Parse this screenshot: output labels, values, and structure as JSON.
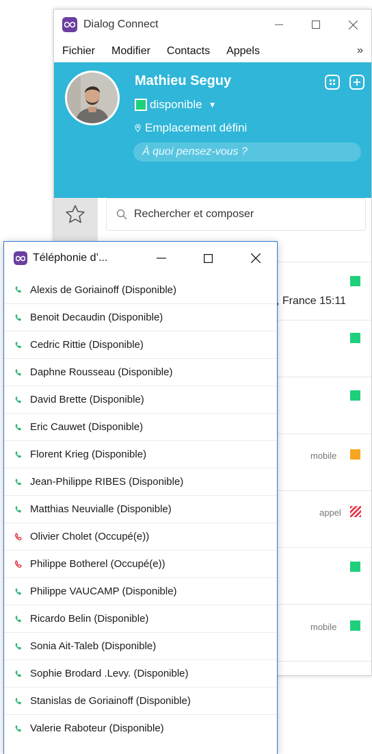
{
  "main_window": {
    "title": "Dialog Connect",
    "menu": [
      "Fichier",
      "Modifier",
      "Contacts",
      "Appels"
    ],
    "menu_more": "»",
    "profile": {
      "name": "Mathieu Seguy",
      "status": "disponible",
      "location": "Emplacement défini",
      "mood_placeholder": "À quoi pensez-vous ?"
    },
    "search_placeholder": "Rechercher et composer",
    "partial_texts": {
      "row1": ", France 15:11",
      "mobile": "mobile",
      "appel": "appel"
    },
    "colors": {
      "header": "#2fb6d8",
      "available": "#1fd07a",
      "mobile": "#f6a623",
      "busy": "#e83a4c",
      "logo": "#6b3fa0"
    }
  },
  "telephony_window": {
    "title": "Téléphonie d’...",
    "contacts": [
      {
        "name": "Alexis de Goriainoff (Disponible)",
        "status": "available"
      },
      {
        "name": "Benoit Decaudin (Disponible)",
        "status": "available"
      },
      {
        "name": "Cedric Rittie (Disponible)",
        "status": "available"
      },
      {
        "name": "Daphne Rousseau (Disponible)",
        "status": "available"
      },
      {
        "name": "David Brette (Disponible)",
        "status": "available"
      },
      {
        "name": "Eric Cauwet (Disponible)",
        "status": "available"
      },
      {
        "name": "Florent Krieg (Disponible)",
        "status": "available"
      },
      {
        "name": "Jean-Philippe RIBES (Disponible)",
        "status": "available"
      },
      {
        "name": "Matthias Neuvialle (Disponible)",
        "status": "available"
      },
      {
        "name": "Olivier Cholet (Occupé(e))",
        "status": "busy"
      },
      {
        "name": "Philippe Botherel (Occupé(e))",
        "status": "busy"
      },
      {
        "name": "Philippe VAUCAMP (Disponible)",
        "status": "available"
      },
      {
        "name": "Ricardo Belin (Disponible)",
        "status": "available"
      },
      {
        "name": "Sonia Ait-Taleb (Disponible)",
        "status": "available"
      },
      {
        "name": "Sophie Brodard .Levy. (Disponible)",
        "status": "available"
      },
      {
        "name": "Stanislas de Goriainoff (Disponible)",
        "status": "available"
      },
      {
        "name": "Valerie Raboteur (Disponible)",
        "status": "available"
      }
    ]
  }
}
